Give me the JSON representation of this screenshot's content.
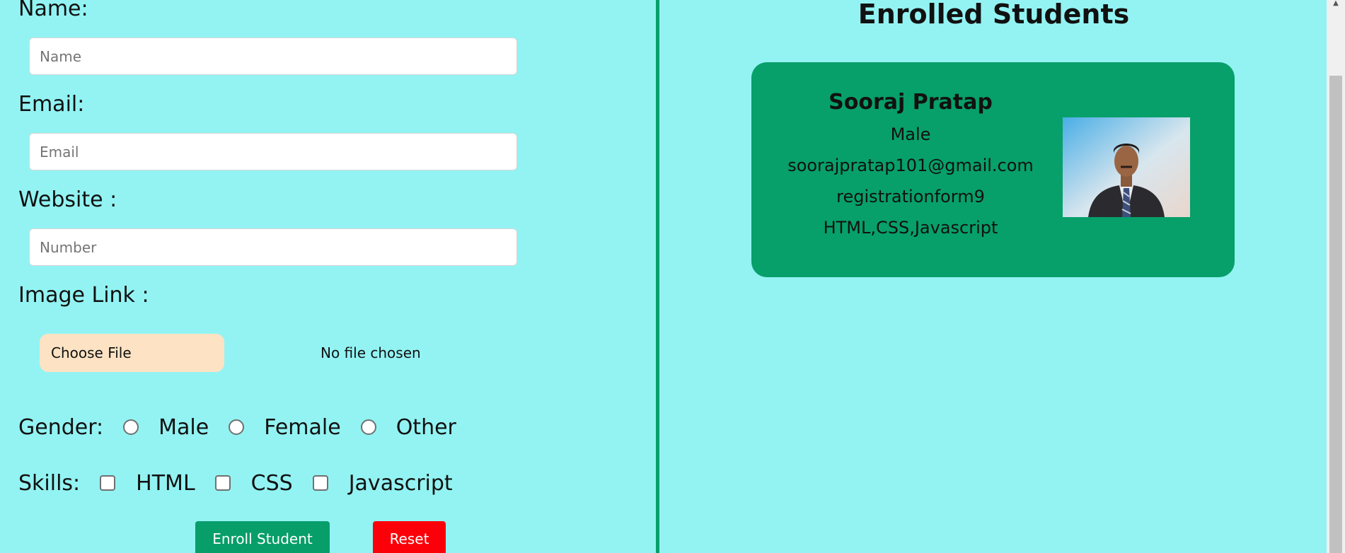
{
  "form": {
    "name_label": "Name:",
    "name_placeholder": "Name",
    "email_label": "Email:",
    "email_placeholder": "Email",
    "website_label": "Website :",
    "website_placeholder": "Number",
    "image_label": "Image Link :",
    "choose_file_label": "Choose File",
    "file_status": "No file chosen",
    "gender_label": "Gender:",
    "gender_options": [
      "Male",
      "Female",
      "Other"
    ],
    "skills_label": "Skills:",
    "skills_options": [
      "HTML",
      "CSS",
      "Javascript"
    ],
    "enroll_label": "Enroll Student",
    "reset_label": "Reset"
  },
  "enrolled": {
    "title": "Enrolled Students",
    "students": [
      {
        "name": "Sooraj Pratap",
        "gender": "Male",
        "email": "soorajpratap101@gmail.com",
        "website": "registrationform9",
        "skills": "HTML,CSS,Javascript",
        "photo_icon": "student-photo"
      }
    ]
  },
  "colors": {
    "background": "#93f3f3",
    "accent": "#079e6a",
    "reset": "#fb0008",
    "file_button": "#fde3c3"
  }
}
